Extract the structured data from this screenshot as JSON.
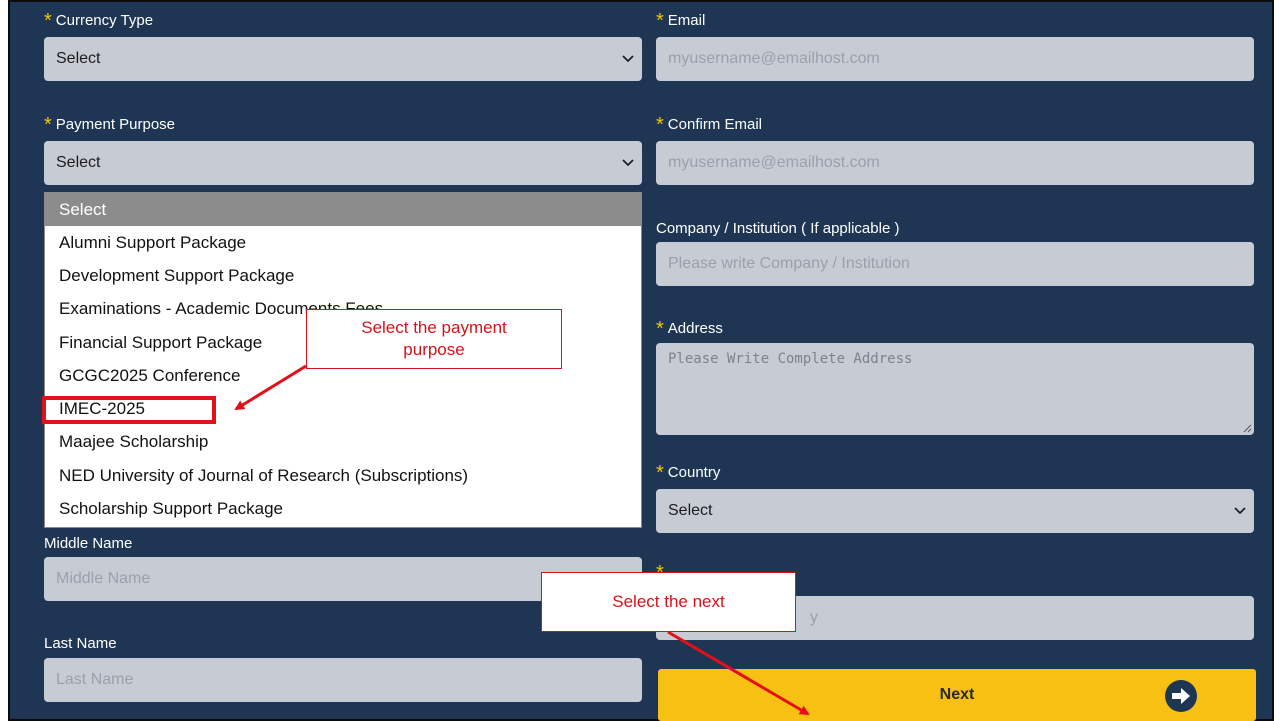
{
  "form": {
    "currency_label": "Currency Type",
    "currency_value": "Select",
    "email_label": "Email",
    "email_placeholder": "myusername@emailhost.com",
    "purpose_label": "Payment Purpose",
    "purpose_value": "Select",
    "confirm_email_label": "Confirm Email",
    "confirm_email_placeholder": "myusername@emailhost.com",
    "company_label": "Company / Institution ( If applicable )",
    "company_placeholder": "Please write Company / Institution",
    "address_label": "Address",
    "address_placeholder": "Please Write Complete Address",
    "country_label": "Country",
    "country_value": "Select",
    "middle_name_label": "Middle Name",
    "middle_name_placeholder": "Middle Name",
    "city_partial_placeholder": "y",
    "last_name_label": "Last Name",
    "last_name_placeholder": "Last Name",
    "next_label": "Next",
    "required_marker": "*"
  },
  "dropdown": {
    "options": [
      "Select",
      "Alumni Support Package",
      "Development Support Package",
      "Examinations - Academic Documents Fees",
      "Financial Support Package",
      "GCGC2025 Conference",
      "IMEC-2025",
      "Maajee Scholarship",
      "NED University of Journal of Research (Subscriptions)",
      "Scholarship Support Package"
    ],
    "highlighted": "Select"
  },
  "annotations": {
    "callout_purpose_line1": "Select the payment",
    "callout_purpose_line2": "purpose",
    "callout_next": "Select the next"
  },
  "colors": {
    "background": "#1e3654",
    "field": "#c7ccd4",
    "required_star": "#f5c400",
    "next_button": "#f7c012",
    "annotation_red": "#e3101a"
  },
  "icons": {
    "select_chevron": "chevron-down-icon",
    "next_arrow": "arrow-right-circle-icon"
  }
}
